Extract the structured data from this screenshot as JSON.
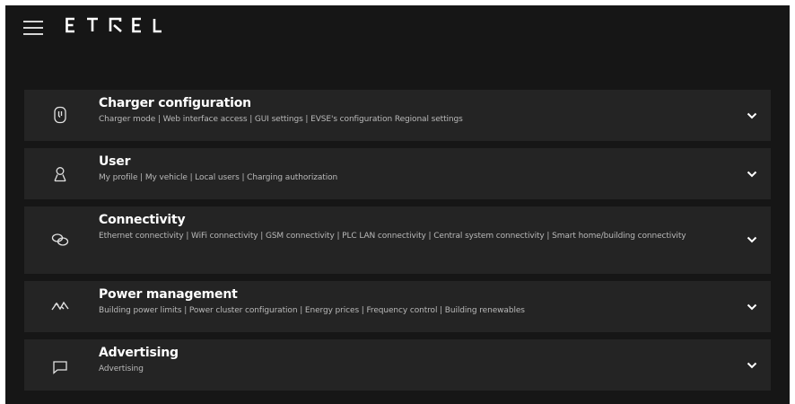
{
  "header": {
    "brand": "ETREL",
    "menu_icon": "hamburger-menu-icon"
  },
  "sections": [
    {
      "title": "Charger configuration",
      "subtitle": "Charger mode | Web interface access | GUI settings | EVSE's configuration Regional settings",
      "icon": "charger-plug-icon"
    },
    {
      "title": "User",
      "subtitle": "My profile | My vehicle | Local users | Charging authorization",
      "icon": "user-icon"
    },
    {
      "title": "Connectivity",
      "subtitle": "Ethernet connectivity | WiFi connectivity | GSM connectivity | PLC LAN connectivity | Central system connectivity | Smart home/building connectivity",
      "icon": "link-icon"
    },
    {
      "title": "Power management",
      "subtitle": "Building power limits | Power cluster configuration | Energy prices | Frequency control | Building renewables",
      "icon": "power-flow-icon"
    },
    {
      "title": "Advertising",
      "subtitle": "Advertising",
      "icon": "message-icon"
    }
  ],
  "colors": {
    "background": "#161616",
    "card": "#242424",
    "title": "#ffffff",
    "subtitle": "#b9b9b9"
  }
}
